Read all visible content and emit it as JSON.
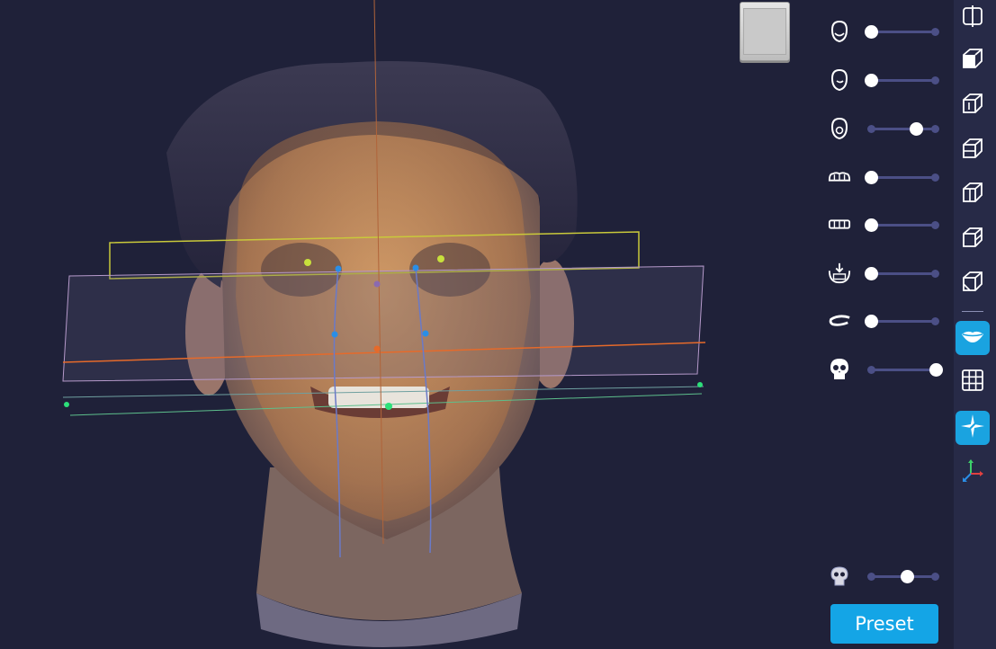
{
  "viewer": {
    "accent_color": "#1aa3e0",
    "background_color": "#1f2139"
  },
  "layer_panel": {
    "sliders": [
      {
        "icon": "face-front-icon",
        "value": 0
      },
      {
        "icon": "face-side-icon",
        "value": 0
      },
      {
        "icon": "face-inner-icon",
        "value": 0.7
      },
      {
        "icon": "upper-teeth-icon",
        "value": 0
      },
      {
        "icon": "lower-teeth-icon",
        "value": 0
      },
      {
        "icon": "teeth-import-icon",
        "value": 0
      },
      {
        "icon": "lip-icon",
        "value": 0
      },
      {
        "icon": "skull-icon",
        "value": 1
      }
    ],
    "bottom_slider": {
      "icon": "skull-outline-icon",
      "value": 0.55
    },
    "preset_label": "Preset"
  },
  "toolbar": {
    "tools": [
      {
        "icon": "split-view-icon",
        "active": false
      },
      {
        "icon": "cube-solid-icon",
        "active": false
      },
      {
        "icon": "cube-wire-1-icon",
        "active": false
      },
      {
        "icon": "cube-wire-2-icon",
        "active": false
      },
      {
        "icon": "cube-wire-3-icon",
        "active": false
      },
      {
        "icon": "cube-wire-4-icon",
        "active": false
      },
      {
        "icon": "cube-wire-5-icon",
        "active": false
      },
      {
        "icon": "lips-icon",
        "active": true
      },
      {
        "icon": "grid-icon",
        "active": false
      },
      {
        "icon": "plane-cross-icon",
        "active": true
      },
      {
        "icon": "axes-icon",
        "active": false
      }
    ]
  }
}
